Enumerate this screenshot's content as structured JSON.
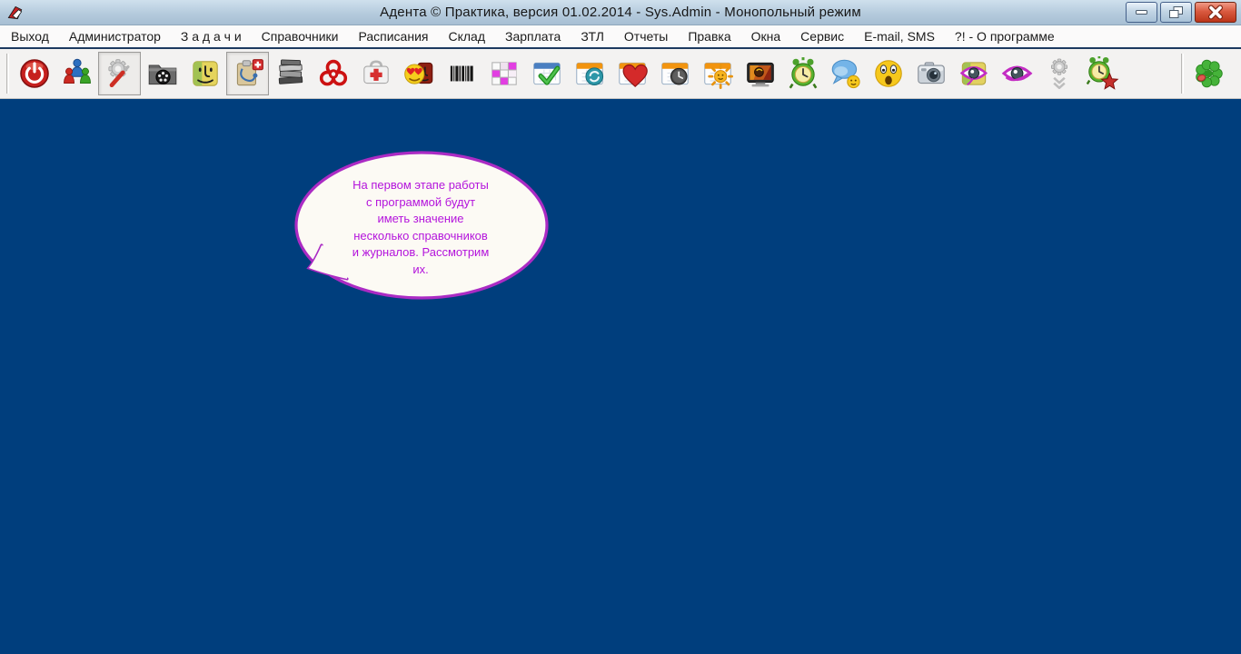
{
  "window": {
    "title": "Адента © Практика, версия 01.02.2014 - Sys.Admin - Монопольный режим",
    "controls": [
      {
        "name": "minimize-button",
        "icon": "minimize-icon"
      },
      {
        "name": "restore-button",
        "icon": "restore-icon"
      },
      {
        "name": "close-button",
        "icon": "close-icon"
      }
    ],
    "app_icon": "app-logo-icon"
  },
  "menubar": {
    "items": [
      "Выход",
      "Администратор",
      "З а д а ч и",
      "Справочники",
      "Расписания",
      "Склад",
      "Зарплата",
      "ЗТЛ",
      "Отчеты",
      "Правка",
      "Окна",
      "Сервис",
      "E-mail, SMS",
      "?! - О программе"
    ]
  },
  "toolbar": {
    "buttons": [
      {
        "icon": "power-icon",
        "checked": false
      },
      {
        "icon": "users-icon",
        "checked": false
      },
      {
        "icon": "tools-gear-screwdriver-icon",
        "checked": true
      },
      {
        "icon": "video-folder-icon",
        "checked": false
      },
      {
        "icon": "finder-face-icon",
        "checked": false
      },
      {
        "icon": "medical-clipboard-icon",
        "checked": true
      },
      {
        "icon": "books-stack-icon",
        "checked": false
      },
      {
        "icon": "biohazard-icon",
        "checked": false
      },
      {
        "icon": "first-aid-kit-icon",
        "checked": false
      },
      {
        "icon": "love-smiley-icon",
        "checked": false
      },
      {
        "icon": "barcode-icon",
        "checked": false
      },
      {
        "icon": "schedule-grid-icon",
        "checked": false
      },
      {
        "icon": "calendar-check-icon",
        "checked": false
      },
      {
        "icon": "calendar-refresh-icon",
        "checked": false
      },
      {
        "icon": "calendar-heart-icon",
        "checked": false
      },
      {
        "icon": "calendar-clock-icon",
        "checked": false
      },
      {
        "icon": "calendar-sun-icon",
        "checked": false
      },
      {
        "icon": "tv-screen-icon",
        "checked": false
      },
      {
        "icon": "alarm-clock-icon",
        "checked": false
      },
      {
        "icon": "chat-bubbles-icon",
        "checked": false
      },
      {
        "icon": "surprised-emoji-icon",
        "checked": false
      },
      {
        "icon": "camera-icon",
        "checked": false
      },
      {
        "icon": "eye-finder-icon",
        "checked": false
      },
      {
        "icon": "eye-icon",
        "checked": false
      },
      {
        "icon": "gear-download-icon",
        "checked": false
      },
      {
        "icon": "alarm-star-icon",
        "checked": false
      },
      {
        "icon": "clover-flower-icon",
        "checked": false
      }
    ]
  },
  "tooltip_bubble": {
    "text": "На первом этапе работы\nс программой будут\nиметь значение\nнесколько справочников\nи журналов. Рассмотрим\nих."
  },
  "colors": {
    "desktop": "#003E7D",
    "titlebar": "#B5CBDD",
    "bubble_fill": "#FCFAF4",
    "bubble_border": "#AB2BC4",
    "bubble_text": "#B414DC"
  }
}
